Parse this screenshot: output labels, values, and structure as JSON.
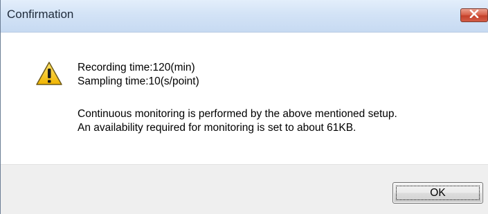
{
  "window": {
    "title": "Confirmation",
    "close_icon": "close-x-icon",
    "close_color": "#c74a33"
  },
  "message": {
    "icon": "warning-triangle-icon",
    "icon_color": "#f3c112",
    "lines": [
      "Recording time:120(min)",
      "Sampling time:10(s/point)",
      "Continuous monitoring is performed by the above mentioned setup.",
      "An availability required for monitoring is set to about 61KB."
    ]
  },
  "buttons": {
    "ok_label": "OK"
  }
}
